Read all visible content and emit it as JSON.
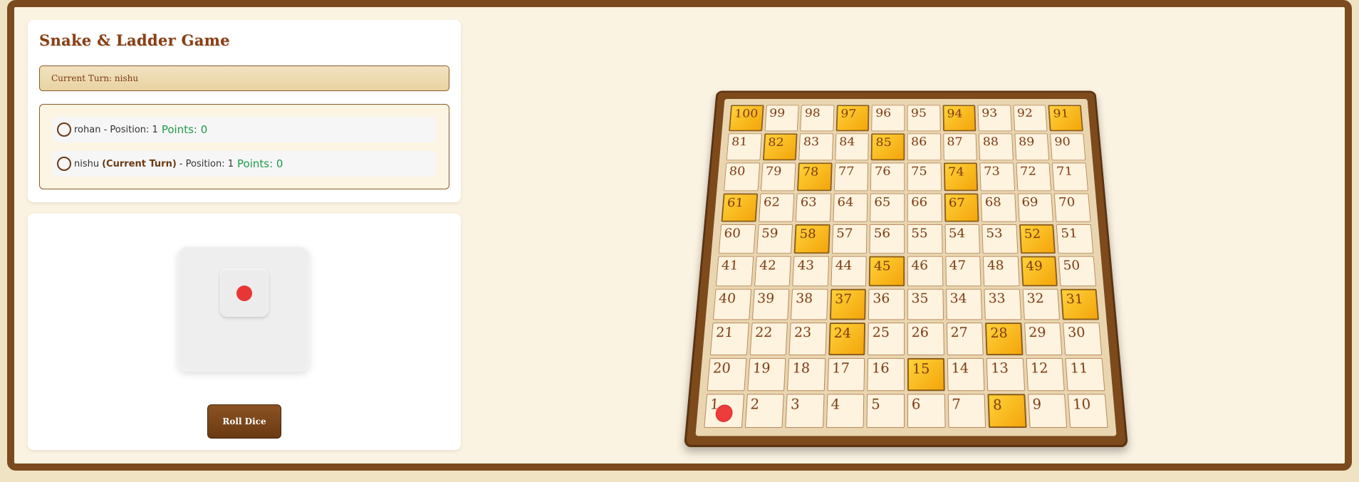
{
  "game": {
    "title": "Snake & Ladder Game",
    "current_turn_text": "Current Turn: nishu"
  },
  "players": [
    {
      "name": "rohan",
      "current_turn_label": "",
      "position_text": " - Position: 1",
      "points_text": "Points: 0"
    },
    {
      "name": "nishu",
      "current_turn_label": "(Current Turn)",
      "position_text": "- Position: 1",
      "points_text": "Points: 0"
    }
  ],
  "dice": {
    "value": 1,
    "roll_label": "Roll Dice",
    "pip_color": "#ea3535"
  },
  "board": {
    "rows": [
      [
        100,
        99,
        98,
        97,
        96,
        95,
        94,
        93,
        92,
        91
      ],
      [
        81,
        82,
        83,
        84,
        85,
        86,
        87,
        88,
        89,
        90
      ],
      [
        80,
        79,
        78,
        77,
        76,
        75,
        74,
        73,
        72,
        71
      ],
      [
        61,
        62,
        63,
        64,
        65,
        66,
        67,
        68,
        69,
        70
      ],
      [
        60,
        59,
        58,
        57,
        56,
        55,
        54,
        53,
        52,
        51
      ],
      [
        41,
        42,
        43,
        44,
        45,
        46,
        47,
        48,
        49,
        50
      ],
      [
        40,
        39,
        38,
        37,
        36,
        35,
        34,
        33,
        32,
        31
      ],
      [
        21,
        22,
        23,
        24,
        25,
        26,
        27,
        28,
        29,
        30
      ],
      [
        20,
        19,
        18,
        17,
        16,
        15,
        14,
        13,
        12,
        11
      ],
      [
        1,
        2,
        3,
        4,
        5,
        6,
        7,
        8,
        9,
        10
      ]
    ],
    "highlighted_cells": [
      100,
      97,
      94,
      91,
      82,
      85,
      78,
      74,
      61,
      67,
      58,
      52,
      45,
      49,
      37,
      31,
      24,
      28,
      15,
      8
    ],
    "token_cell": 1,
    "colors": {
      "highlight": "#f3a50a",
      "token": "#ee3b3b",
      "frame": "#7d4a1c"
    }
  }
}
